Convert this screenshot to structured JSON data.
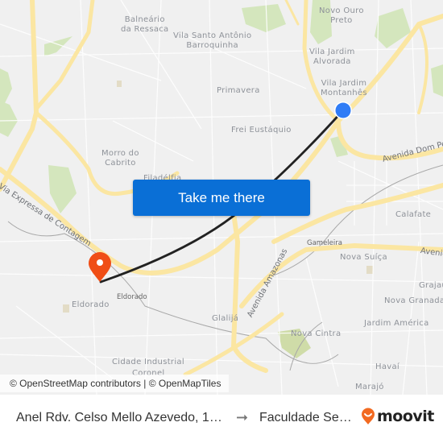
{
  "map": {
    "places": [
      {
        "name": "Balneário\nda Ressaca"
      },
      {
        "name": "Vila Santo Antônio\nBarroquinha"
      },
      {
        "name": "Novo Ouro\nPreto"
      },
      {
        "name": "Vila Jardim\nAlvorada"
      },
      {
        "name": "Vila Jardim\nMontanhês"
      },
      {
        "name": "Primavera"
      },
      {
        "name": "Frei Eustáquio"
      },
      {
        "name": "Morro do\nCabrito"
      },
      {
        "name": "Filadélfia"
      },
      {
        "name": "Calafate"
      },
      {
        "name": "Gameleira"
      },
      {
        "name": "Nova Suíça"
      },
      {
        "name": "Grajaú"
      },
      {
        "name": "Nova Granada"
      },
      {
        "name": "Jardim América"
      },
      {
        "name": "Eldorado"
      },
      {
        "name": "Eldorado"
      },
      {
        "name": "Glalijá"
      },
      {
        "name": "Nova Cintra"
      },
      {
        "name": "Havaí"
      },
      {
        "name": "Marajó"
      },
      {
        "name": "Cidade Industrial"
      },
      {
        "name": "Coronel"
      }
    ],
    "roads": [
      {
        "name": "Avenida Dom Pedro"
      },
      {
        "name": "Via Expressa de Contagem"
      },
      {
        "name": "Avenida Amazonas"
      },
      {
        "name": "Avenida"
      }
    ],
    "colors": {
      "background": "#f0f0f0",
      "major_road": "#fbe6a2",
      "park": "#cfe3b4",
      "route_line": "#222222",
      "origin_marker": "#2f7cf6",
      "destination_marker": "#f04e16"
    },
    "origin_marker": {
      "icon": "location-dot-icon"
    },
    "destination_marker": {
      "icon": "map-pin-icon"
    }
  },
  "cta": {
    "label": "Take me there"
  },
  "attribution": {
    "text": "© OpenStreetMap contributors | © OpenMapTiles"
  },
  "footer": {
    "origin": "Anel Rdv. Celso Mello Azevedo, 1…",
    "arrow_icon": "arrow-right-icon",
    "destination": "Faculdade Se…",
    "brand": "moovit",
    "brand_color": "#f26a21"
  }
}
